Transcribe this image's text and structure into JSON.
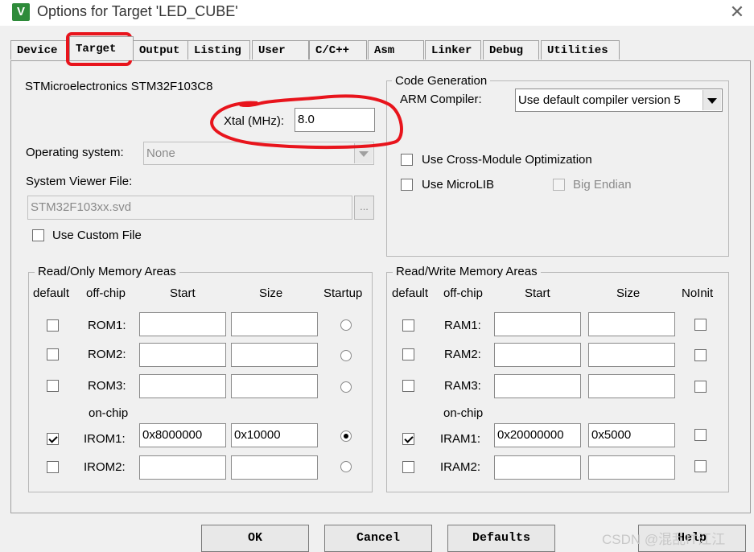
{
  "window": {
    "title": "Options for Target 'LED_CUBE'",
    "app_icon_text": "V",
    "close_glyph": "✕"
  },
  "tabs": [
    {
      "label": "Device",
      "active": false
    },
    {
      "label": "Target",
      "active": true
    },
    {
      "label": "Output",
      "active": false
    },
    {
      "label": "Listing",
      "active": false
    },
    {
      "label": "User",
      "active": false
    },
    {
      "label": "C/C++",
      "active": false
    },
    {
      "label": "Asm",
      "active": false
    },
    {
      "label": "Linker",
      "active": false
    },
    {
      "label": "Debug",
      "active": false
    },
    {
      "label": "Utilities",
      "active": false
    }
  ],
  "device": {
    "name": "STMicroelectronics STM32F103C8",
    "xtal_label": "Xtal (MHz):",
    "xtal_value": "8.0",
    "os_label": "Operating system:",
    "os_value": "None",
    "svf_label": "System Viewer File:",
    "svf_value": "STM32F103xx.svd",
    "svf_browse": "...",
    "custom_file_label": "Use Custom File"
  },
  "code_generation": {
    "title": "Code Generation",
    "compiler_label": "ARM Compiler:",
    "compiler_value": "Use default compiler version 5",
    "cross_module_label": "Use Cross-Module Optimization",
    "microlib_label": "Use MicroLIB",
    "big_endian_label": "Big Endian"
  },
  "ro_memory": {
    "title": "Read/Only Memory Areas",
    "headers": {
      "default": "default",
      "offchip": "off-chip",
      "start": "Start",
      "size": "Size",
      "startup": "Startup"
    },
    "onchip_label": "on-chip",
    "rows": [
      {
        "name": "ROM1:",
        "default": false,
        "start": "",
        "size": "",
        "startup": false
      },
      {
        "name": "ROM2:",
        "default": false,
        "start": "",
        "size": "",
        "startup": false
      },
      {
        "name": "ROM3:",
        "default": false,
        "start": "",
        "size": "",
        "startup": false
      },
      {
        "name": "IROM1:",
        "default": true,
        "start": "0x8000000",
        "size": "0x10000",
        "startup": true
      },
      {
        "name": "IROM2:",
        "default": false,
        "start": "",
        "size": "",
        "startup": false
      }
    ]
  },
  "rw_memory": {
    "title": "Read/Write Memory Areas",
    "headers": {
      "default": "default",
      "offchip": "off-chip",
      "start": "Start",
      "size": "Size",
      "noinit": "NoInit"
    },
    "onchip_label": "on-chip",
    "rows": [
      {
        "name": "RAM1:",
        "default": false,
        "start": "",
        "size": "",
        "noinit": false
      },
      {
        "name": "RAM2:",
        "default": false,
        "start": "",
        "size": "",
        "noinit": false
      },
      {
        "name": "RAM3:",
        "default": false,
        "start": "",
        "size": "",
        "noinit": false
      },
      {
        "name": "IRAM1:",
        "default": true,
        "start": "0x20000000",
        "size": "0x5000",
        "noinit": false
      },
      {
        "name": "IRAM2:",
        "default": false,
        "start": "",
        "size": "",
        "noinit": false
      }
    ]
  },
  "buttons": {
    "ok": "OK",
    "cancel": "Cancel",
    "defaults": "Defaults",
    "help": "Help"
  },
  "watermark": "CSDN @混乱IT江江",
  "annotation_color": "#e8141c"
}
